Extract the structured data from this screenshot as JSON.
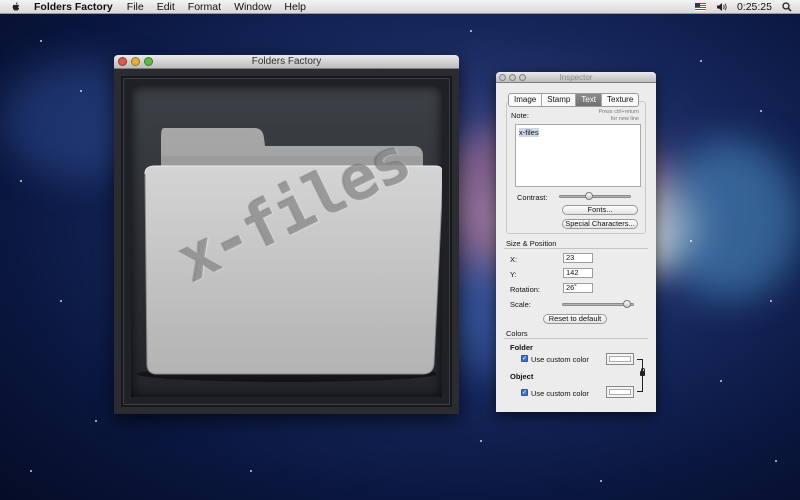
{
  "menubar": {
    "app_name": "Folders Factory",
    "menus": [
      "File",
      "Edit",
      "Format",
      "Window",
      "Help"
    ],
    "clock": "0:25:25",
    "icons": [
      "apple-icon",
      "flag-icon",
      "volume-icon",
      "search-icon"
    ]
  },
  "main_window": {
    "title": "Folders Factory",
    "folder_text": "x-files"
  },
  "inspector": {
    "title": "Inspector",
    "tabs": [
      {
        "label": "Image",
        "active": false
      },
      {
        "label": "Stamp",
        "active": false
      },
      {
        "label": "Text",
        "active": true
      },
      {
        "label": "Texture",
        "active": false
      }
    ],
    "note_label": "Note:",
    "note_hint_line1": "Press ctrl+return",
    "note_hint_line2": "for new line",
    "note_value": "x-files",
    "contrast_label": "Contrast:",
    "contrast_level": 0.4,
    "fonts_button": "Fonts...",
    "special_chars_button": "Special Characters...",
    "size_position_title": "Size & Position",
    "x_label": "X:",
    "x_value": "23",
    "y_label": "Y:",
    "y_value": "142",
    "rotation_label": "Rotation:",
    "rotation_value": "26˚",
    "scale_label": "Scale:",
    "scale_level": 0.97,
    "reset_button": "Reset to default",
    "colors_title": "Colors",
    "folder_title": "Folder",
    "folder_custom_label": "Use custom color",
    "folder_custom_checked": true,
    "object_title": "Object",
    "object_custom_label": "Use custom color",
    "object_custom_checked": true,
    "folder_swatch_color": "#ffffff",
    "object_swatch_color": "#ffffff"
  }
}
